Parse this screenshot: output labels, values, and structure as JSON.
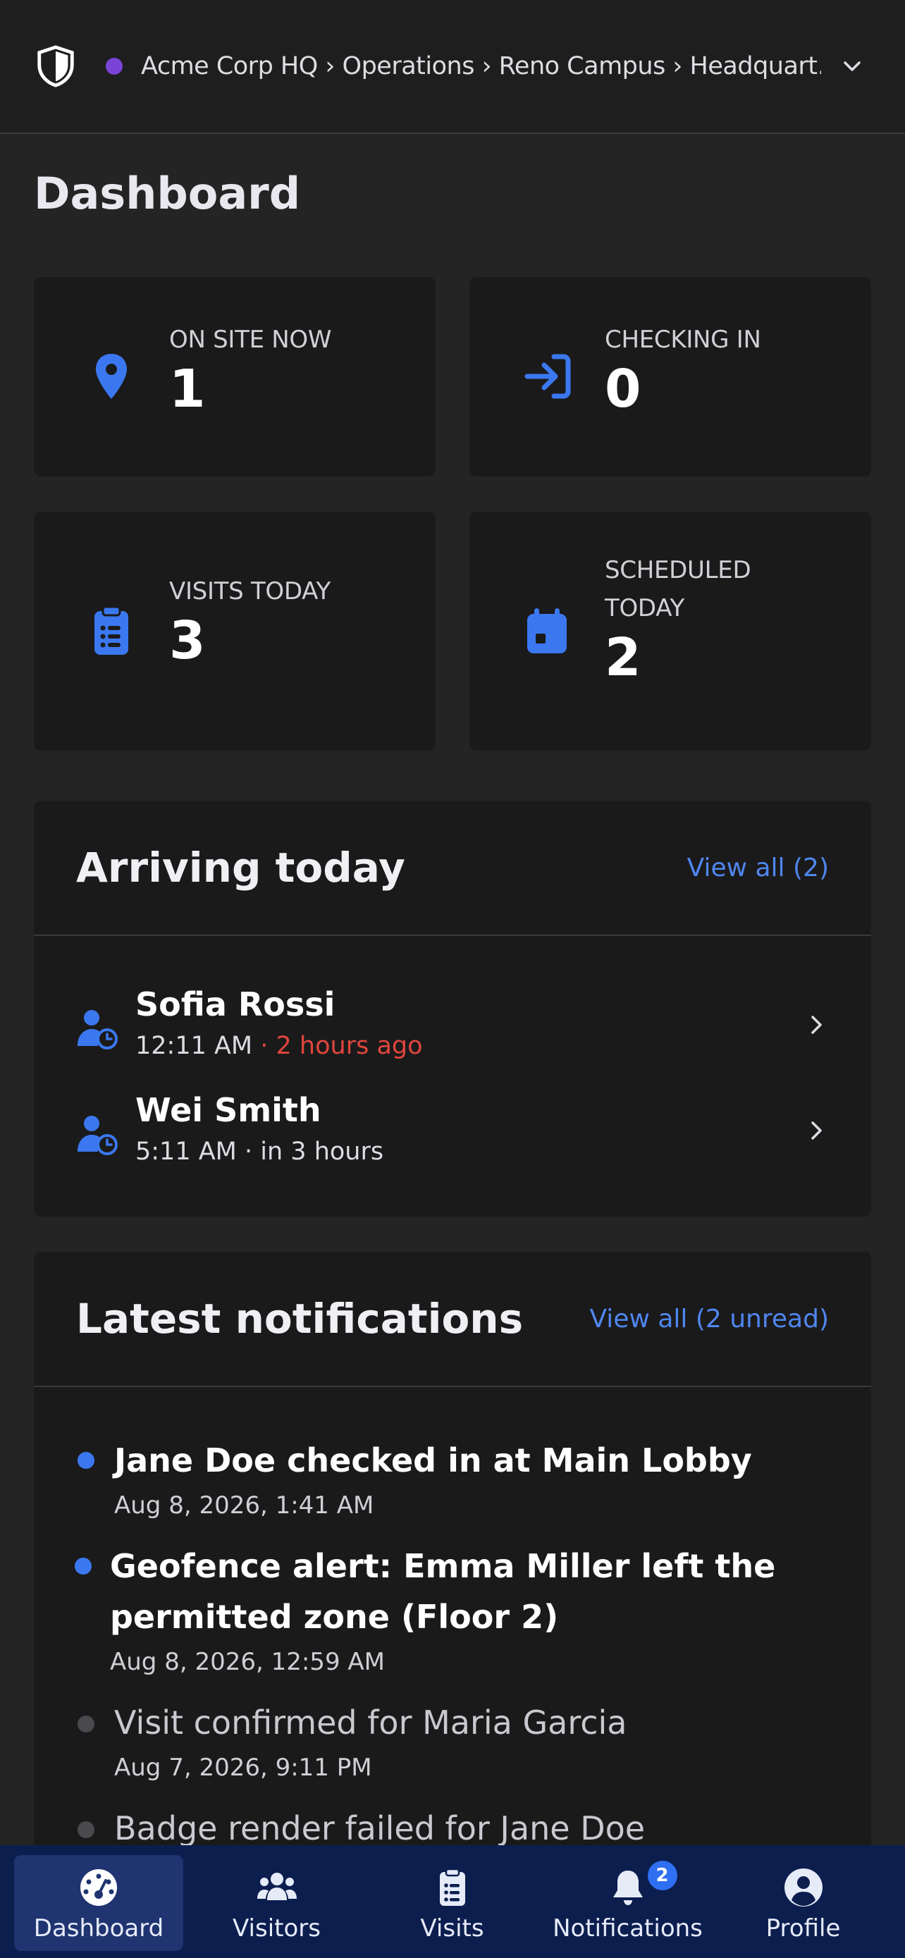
{
  "header": {
    "breadcrumb": "Acme Corp HQ › Operations › Reno Campus › Headquart…",
    "dot_color": "#7a45d6"
  },
  "page": {
    "title": "Dashboard"
  },
  "stats": [
    {
      "label": "ON SITE NOW",
      "value": "1",
      "icon": "map-pin-icon"
    },
    {
      "label": "CHECKING IN",
      "value": "0",
      "icon": "sign-in-icon"
    },
    {
      "label": "VISITS TODAY",
      "value": "3",
      "icon": "clipboard-list-icon"
    },
    {
      "label_line1": "SCHEDULED",
      "label_line2": "TODAY",
      "value": "2",
      "icon": "calendar-icon"
    }
  ],
  "arriving": {
    "title": "Arriving today",
    "view_all": "View all (2)",
    "items": [
      {
        "name": "Sofia Rossi",
        "time": "12:11 AM",
        "relative": "2 hours ago",
        "late": true
      },
      {
        "name": "Wei Smith",
        "time": "5:11 AM",
        "relative": "in 3 hours",
        "late": false
      }
    ]
  },
  "notifications": {
    "title": "Latest notifications",
    "view_all": "View all (2 unread)",
    "items": [
      {
        "text": "Jane Doe checked in at Main Lobby",
        "date": "Aug 8, 2026, 1:41 AM",
        "unread": true
      },
      {
        "text_line1": "Geofence alert: Emma Miller left the",
        "text_line2": "permitted zone (Floor 2)",
        "date": "Aug 8, 2026, 12:59 AM",
        "unread": true
      },
      {
        "text": "Visit confirmed for Maria Garcia",
        "date": "Aug 7, 2026, 9:11 PM",
        "unread": false
      },
      {
        "text": "Badge render failed for Jane Doe",
        "unread": false
      }
    ]
  },
  "nav": {
    "items": [
      {
        "label": "Dashboard",
        "active": true
      },
      {
        "label": "Visitors"
      },
      {
        "label": "Visits"
      },
      {
        "label": "Notifications",
        "badge": "2"
      },
      {
        "label": "Profile"
      }
    ]
  },
  "colors": {
    "accent": "#3b78f0",
    "late": "#e0463d",
    "nav_bg": "#0c1e4e"
  }
}
